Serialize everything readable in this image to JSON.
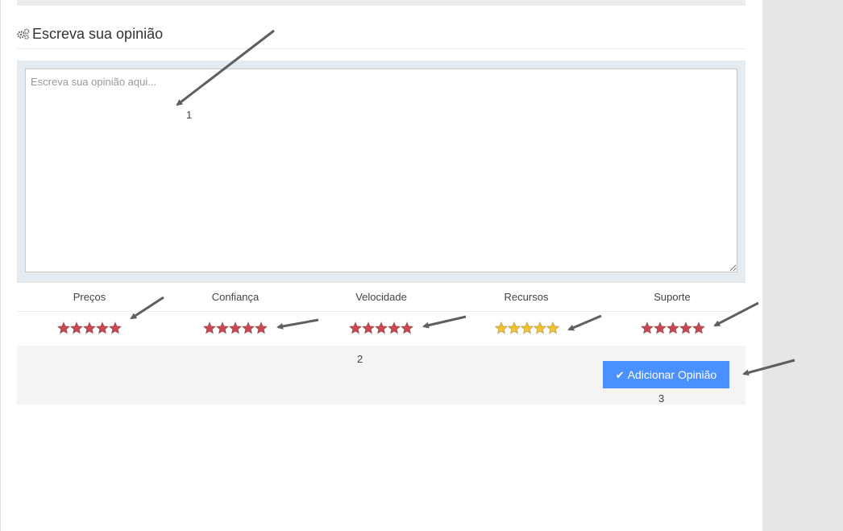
{
  "section": {
    "title": "Escreva sua opinião",
    "icon": "gears-icon"
  },
  "opinion": {
    "placeholder": "Escreva sua opinião aqui...",
    "value": ""
  },
  "ratings": [
    {
      "label": "Preços",
      "stars": 5,
      "color": "#c9484f"
    },
    {
      "label": "Confiança",
      "stars": 5,
      "color": "#c9484f"
    },
    {
      "label": "Velocidade",
      "stars": 5,
      "color": "#c9484f"
    },
    {
      "label": "Recursos",
      "stars": 5,
      "color": "#f2c230"
    },
    {
      "label": "Suporte",
      "stars": 5,
      "color": "#c9484f"
    }
  ],
  "submit": {
    "label": "Adicionar Opinião",
    "icon": "check-icon"
  },
  "annotations": {
    "one": "1",
    "two": "2",
    "three": "3"
  },
  "colors": {
    "button": "#4a90ff",
    "star_red": "#c9484f",
    "star_gold": "#f2c230",
    "arrow": "#5f5f5f"
  }
}
